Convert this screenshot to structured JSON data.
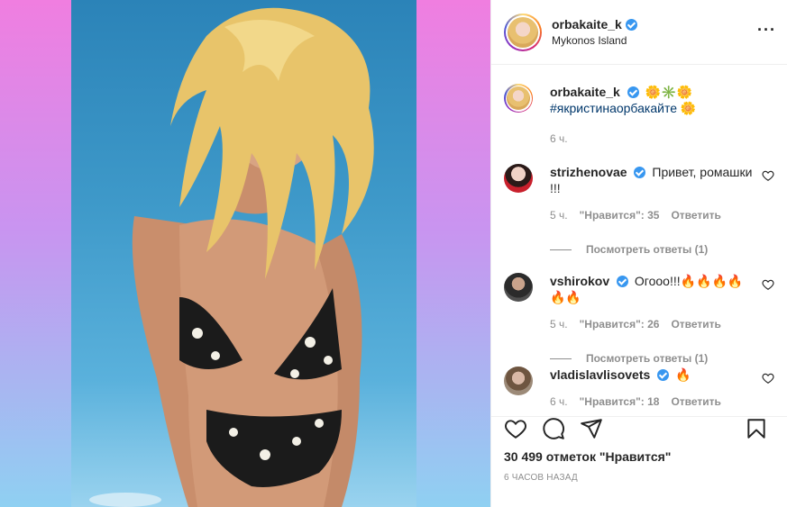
{
  "post": {
    "author": "orbakaite_k",
    "location": "Mykonos Island",
    "caption_emoji": "🌼✳️🌼",
    "hashtag": "#якристинаорбакайте",
    "hashtag_emoji": "🌼",
    "caption_time": "6 ч."
  },
  "comments": [
    {
      "user": "strizhenovae",
      "text": "Привет, ромашки !!!",
      "time": "5 ч.",
      "likes": "\"Нравится\": 35",
      "reply": "Ответить",
      "view_replies": "Посмотреть ответы (1)"
    },
    {
      "user": "vshirokov",
      "text": "Огооо!!!🔥🔥🔥🔥🔥🔥",
      "time": "5 ч.",
      "likes": "\"Нравится\": 26",
      "reply": "Ответить",
      "view_replies": "Посмотреть ответы (1)"
    },
    {
      "user": "vladislavlisovets",
      "text": "🔥",
      "time": "6 ч.",
      "likes": "\"Нравится\": 18",
      "reply": "Ответить"
    }
  ],
  "footer": {
    "likes_count": "30 499 отметок \"Нравится\"",
    "time_ago": "6 часов назад"
  },
  "icons": {
    "more": "more-options-icon",
    "like": "heart-icon",
    "comment": "comment-icon",
    "share": "share-icon",
    "save": "bookmark-icon"
  },
  "colors": {
    "verified": "#3897f0",
    "hashtag": "#00376b",
    "muted": "#8e8e8e"
  }
}
